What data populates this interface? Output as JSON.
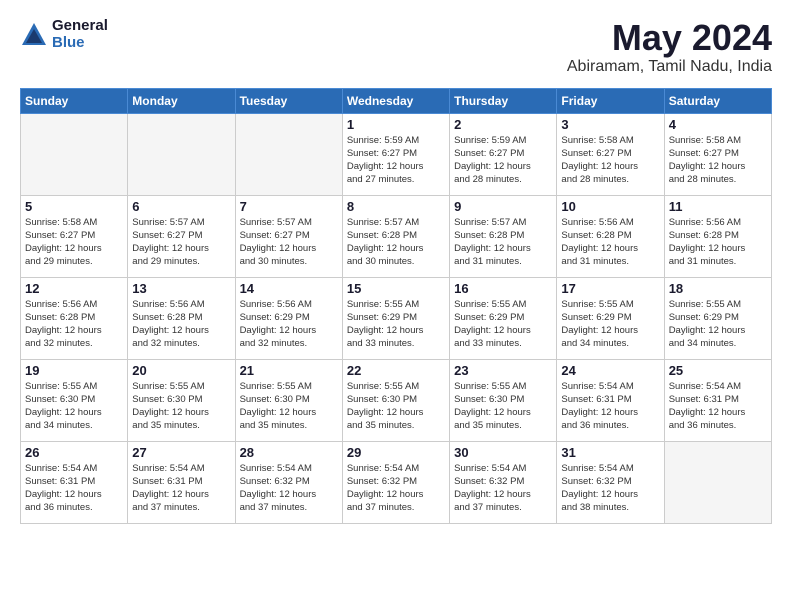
{
  "header": {
    "logo_general": "General",
    "logo_blue": "Blue",
    "title": "May 2024",
    "subtitle": "Abiramam, Tamil Nadu, India"
  },
  "days_of_week": [
    "Sunday",
    "Monday",
    "Tuesday",
    "Wednesday",
    "Thursday",
    "Friday",
    "Saturday"
  ],
  "weeks": [
    [
      {
        "day": "",
        "info": ""
      },
      {
        "day": "",
        "info": ""
      },
      {
        "day": "",
        "info": ""
      },
      {
        "day": "1",
        "info": "Sunrise: 5:59 AM\nSunset: 6:27 PM\nDaylight: 12 hours\nand 27 minutes."
      },
      {
        "day": "2",
        "info": "Sunrise: 5:59 AM\nSunset: 6:27 PM\nDaylight: 12 hours\nand 28 minutes."
      },
      {
        "day": "3",
        "info": "Sunrise: 5:58 AM\nSunset: 6:27 PM\nDaylight: 12 hours\nand 28 minutes."
      },
      {
        "day": "4",
        "info": "Sunrise: 5:58 AM\nSunset: 6:27 PM\nDaylight: 12 hours\nand 28 minutes."
      }
    ],
    [
      {
        "day": "5",
        "info": "Sunrise: 5:58 AM\nSunset: 6:27 PM\nDaylight: 12 hours\nand 29 minutes."
      },
      {
        "day": "6",
        "info": "Sunrise: 5:57 AM\nSunset: 6:27 PM\nDaylight: 12 hours\nand 29 minutes."
      },
      {
        "day": "7",
        "info": "Sunrise: 5:57 AM\nSunset: 6:27 PM\nDaylight: 12 hours\nand 30 minutes."
      },
      {
        "day": "8",
        "info": "Sunrise: 5:57 AM\nSunset: 6:28 PM\nDaylight: 12 hours\nand 30 minutes."
      },
      {
        "day": "9",
        "info": "Sunrise: 5:57 AM\nSunset: 6:28 PM\nDaylight: 12 hours\nand 31 minutes."
      },
      {
        "day": "10",
        "info": "Sunrise: 5:56 AM\nSunset: 6:28 PM\nDaylight: 12 hours\nand 31 minutes."
      },
      {
        "day": "11",
        "info": "Sunrise: 5:56 AM\nSunset: 6:28 PM\nDaylight: 12 hours\nand 31 minutes."
      }
    ],
    [
      {
        "day": "12",
        "info": "Sunrise: 5:56 AM\nSunset: 6:28 PM\nDaylight: 12 hours\nand 32 minutes."
      },
      {
        "day": "13",
        "info": "Sunrise: 5:56 AM\nSunset: 6:28 PM\nDaylight: 12 hours\nand 32 minutes."
      },
      {
        "day": "14",
        "info": "Sunrise: 5:56 AM\nSunset: 6:29 PM\nDaylight: 12 hours\nand 32 minutes."
      },
      {
        "day": "15",
        "info": "Sunrise: 5:55 AM\nSunset: 6:29 PM\nDaylight: 12 hours\nand 33 minutes."
      },
      {
        "day": "16",
        "info": "Sunrise: 5:55 AM\nSunset: 6:29 PM\nDaylight: 12 hours\nand 33 minutes."
      },
      {
        "day": "17",
        "info": "Sunrise: 5:55 AM\nSunset: 6:29 PM\nDaylight: 12 hours\nand 34 minutes."
      },
      {
        "day": "18",
        "info": "Sunrise: 5:55 AM\nSunset: 6:29 PM\nDaylight: 12 hours\nand 34 minutes."
      }
    ],
    [
      {
        "day": "19",
        "info": "Sunrise: 5:55 AM\nSunset: 6:30 PM\nDaylight: 12 hours\nand 34 minutes."
      },
      {
        "day": "20",
        "info": "Sunrise: 5:55 AM\nSunset: 6:30 PM\nDaylight: 12 hours\nand 35 minutes."
      },
      {
        "day": "21",
        "info": "Sunrise: 5:55 AM\nSunset: 6:30 PM\nDaylight: 12 hours\nand 35 minutes."
      },
      {
        "day": "22",
        "info": "Sunrise: 5:55 AM\nSunset: 6:30 PM\nDaylight: 12 hours\nand 35 minutes."
      },
      {
        "day": "23",
        "info": "Sunrise: 5:55 AM\nSunset: 6:30 PM\nDaylight: 12 hours\nand 35 minutes."
      },
      {
        "day": "24",
        "info": "Sunrise: 5:54 AM\nSunset: 6:31 PM\nDaylight: 12 hours\nand 36 minutes."
      },
      {
        "day": "25",
        "info": "Sunrise: 5:54 AM\nSunset: 6:31 PM\nDaylight: 12 hours\nand 36 minutes."
      }
    ],
    [
      {
        "day": "26",
        "info": "Sunrise: 5:54 AM\nSunset: 6:31 PM\nDaylight: 12 hours\nand 36 minutes."
      },
      {
        "day": "27",
        "info": "Sunrise: 5:54 AM\nSunset: 6:31 PM\nDaylight: 12 hours\nand 37 minutes."
      },
      {
        "day": "28",
        "info": "Sunrise: 5:54 AM\nSunset: 6:32 PM\nDaylight: 12 hours\nand 37 minutes."
      },
      {
        "day": "29",
        "info": "Sunrise: 5:54 AM\nSunset: 6:32 PM\nDaylight: 12 hours\nand 37 minutes."
      },
      {
        "day": "30",
        "info": "Sunrise: 5:54 AM\nSunset: 6:32 PM\nDaylight: 12 hours\nand 37 minutes."
      },
      {
        "day": "31",
        "info": "Sunrise: 5:54 AM\nSunset: 6:32 PM\nDaylight: 12 hours\nand 38 minutes."
      },
      {
        "day": "",
        "info": ""
      }
    ]
  ]
}
